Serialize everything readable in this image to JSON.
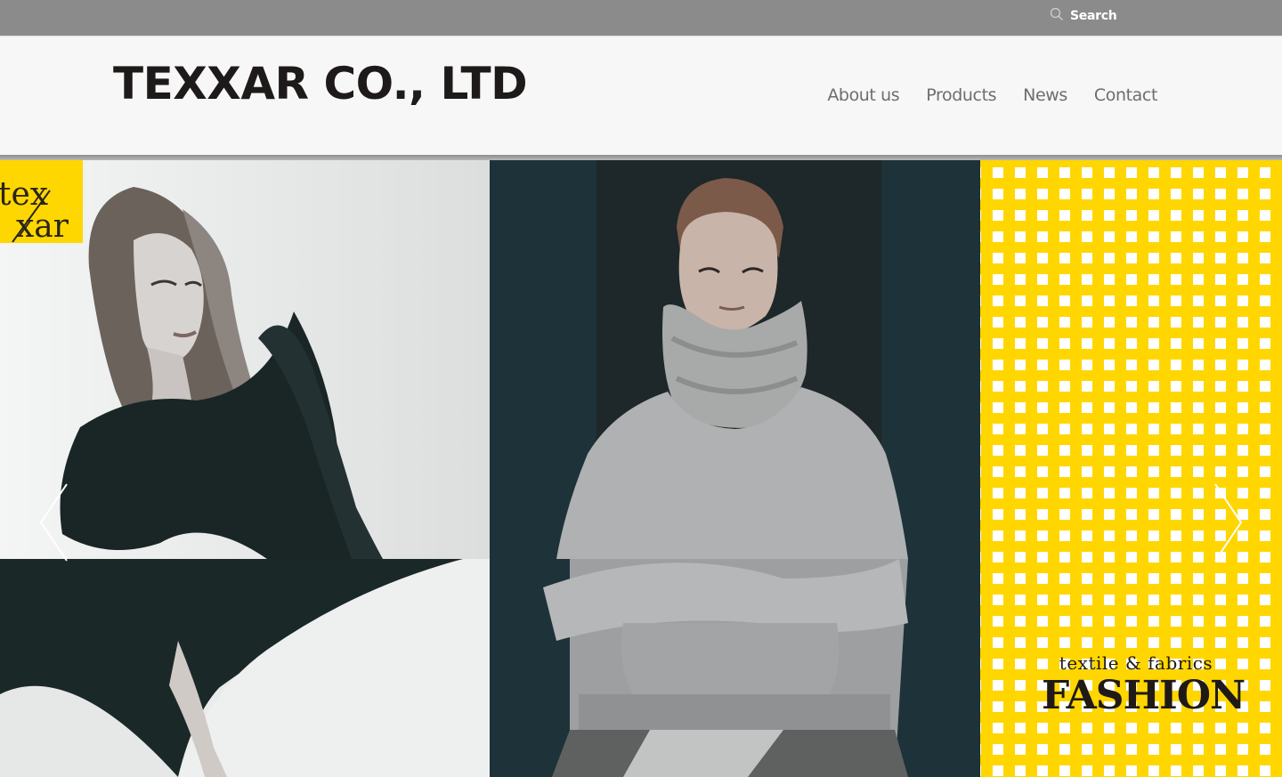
{
  "topbar": {
    "search_label": "Search"
  },
  "header": {
    "company_name": "TEXXAR CO., LTD",
    "nav": [
      {
        "label": "About us"
      },
      {
        "label": "Products"
      },
      {
        "label": "News"
      },
      {
        "label": "Contact"
      }
    ]
  },
  "hero": {
    "badge_text_1": "tex",
    "badge_text_2": "xar",
    "tagline_small": "textile & fabrics",
    "tagline_big": "FASHION"
  },
  "colors": {
    "topbar": "#8b8b8b",
    "brand_yellow": "#ffd600",
    "dark_teal": "#1d3239",
    "logo_text": "#1e1a19",
    "nav_text": "#6d6d6d"
  },
  "icons": {
    "search": "search-icon",
    "prev": "chevron-left-icon",
    "next": "chevron-right-icon"
  }
}
